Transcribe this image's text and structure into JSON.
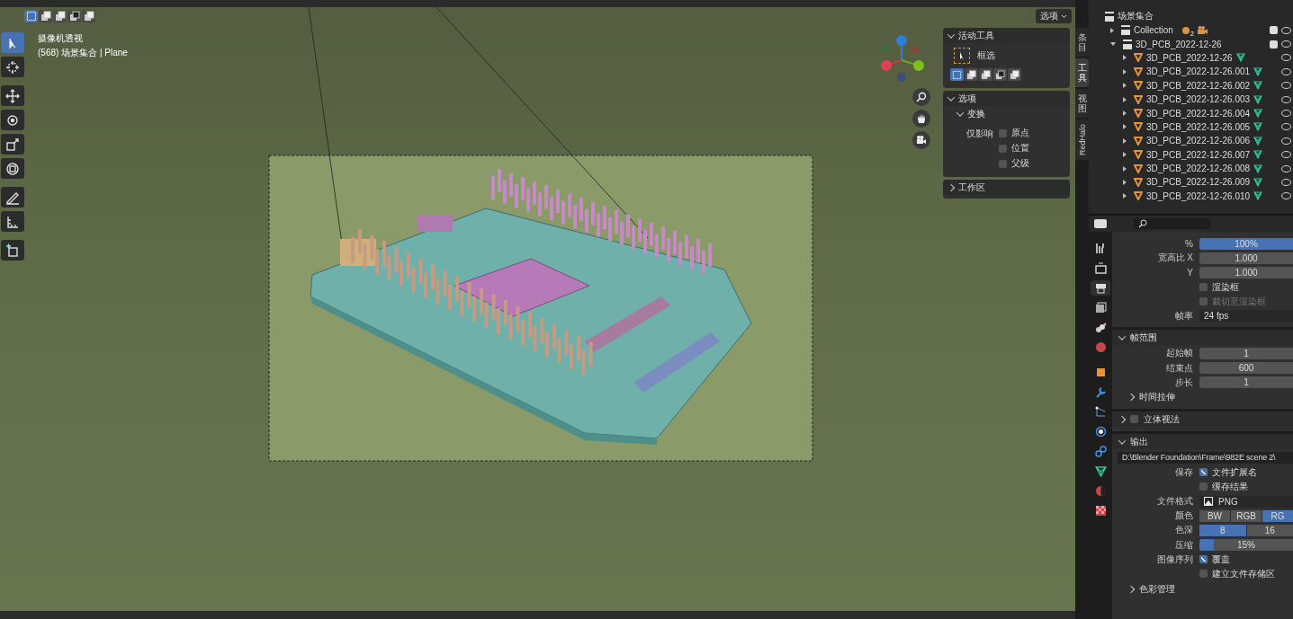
{
  "viewport_header": {
    "select_modes": [
      {
        "selected": true
      },
      {
        "selected": false
      },
      {
        "selected": false
      },
      {
        "selected": false
      },
      {
        "selected": false
      }
    ],
    "options_button": "选项"
  },
  "viewport": {
    "view_name": "摄像机透视",
    "context": "(568) 场景集合 | Plane"
  },
  "tools": [
    {
      "kind": "select",
      "selected": true
    },
    {
      "kind": "cursor",
      "selected": false
    },
    {
      "kind": "move",
      "selected": false
    },
    {
      "kind": "rotate",
      "selected": false
    },
    {
      "kind": "scale",
      "selected": false
    },
    {
      "kind": "transform",
      "selected": false
    },
    {
      "kind": "annotate",
      "selected": false
    },
    {
      "kind": "measure",
      "selected": false
    },
    {
      "kind": "add",
      "selected": false
    }
  ],
  "sidebar_panel": {
    "tool_title": "活动工具",
    "tool_expanded": true,
    "tool_name": "框选",
    "modes": [
      {
        "selected": true
      },
      {
        "selected": false
      },
      {
        "selected": false
      },
      {
        "selected": false
      },
      {
        "selected": false
      }
    ],
    "options_title": "选项",
    "options_expanded": true,
    "transform_title": "变换",
    "transform_expanded": true,
    "affect_label": "仅影响",
    "affect": [
      {
        "label": "原点",
        "checked": false
      },
      {
        "label": "位置",
        "checked": false
      },
      {
        "label": "父级",
        "checked": false
      }
    ],
    "workspace_title": "工作区",
    "workspace_expanded": false
  },
  "sidebar_tabs": [
    {
      "label": "条目",
      "kind": "cjk",
      "selected": false
    },
    {
      "label": "工具",
      "kind": "cjk",
      "selected": true
    },
    {
      "label": "视图",
      "kind": "cjk",
      "selected": false
    },
    {
      "label": "RedHalo",
      "kind": "latin",
      "selected": false
    }
  ],
  "outliner": {
    "root": "场景集合",
    "items": [
      {
        "name": "Collection",
        "expanded": false,
        "checked": true,
        "badge": "2"
      },
      {
        "name": "3D_PCB_2022-12-26",
        "expanded": true,
        "checked": true,
        "children": [
          {
            "name": "3D_PCB_2022-12-26",
            "expanded": false
          },
          {
            "name": "3D_PCB_2022-12-26.001",
            "expanded": false
          },
          {
            "name": "3D_PCB_2022-12-26.002",
            "expanded": false
          },
          {
            "name": "3D_PCB_2022-12-26.003",
            "expanded": false
          },
          {
            "name": "3D_PCB_2022-12-26.004",
            "expanded": false
          },
          {
            "name": "3D_PCB_2022-12-26.005",
            "expanded": false
          },
          {
            "name": "3D_PCB_2022-12-26.006",
            "expanded": false
          },
          {
            "name": "3D_PCB_2022-12-26.007",
            "expanded": false
          },
          {
            "name": "3D_PCB_2022-12-26.008",
            "expanded": false
          },
          {
            "name": "3D_PCB_2022-12-26.009",
            "expanded": false
          },
          {
            "name": "3D_PCB_2022-12-26.010",
            "expanded": false
          }
        ]
      }
    ]
  },
  "properties": {
    "tabs": [
      {
        "kind": "tool",
        "selected": false
      },
      {
        "kind": "render",
        "selected": false
      },
      {
        "kind": "output",
        "selected": true
      },
      {
        "kind": "view_layer",
        "selected": false
      },
      {
        "kind": "scene",
        "selected": false
      },
      {
        "kind": "world",
        "selected": false
      },
      {
        "kind": "object",
        "selected": false
      },
      {
        "kind": "modifier",
        "selected": false
      },
      {
        "kind": "particles",
        "selected": false
      },
      {
        "kind": "physics",
        "selected": false
      },
      {
        "kind": "constraints",
        "selected": false
      },
      {
        "kind": "data",
        "selected": false
      },
      {
        "kind": "material",
        "selected": false
      },
      {
        "kind": "texture",
        "selected": false
      }
    ],
    "rows": [
      {
        "kind": "slider",
        "label": "%",
        "value": "100%",
        "level": 1
      },
      {
        "kind": "number",
        "label": "宽高比 X",
        "value": "1.000"
      },
      {
        "kind": "number",
        "label": "Y",
        "value": "1.000"
      },
      {
        "kind": "checkbox",
        "text": "渲染框",
        "checked": false,
        "disabled": false
      },
      {
        "kind": "checkbox",
        "text": "裁切至渲染框",
        "checked": false,
        "disabled": true
      },
      {
        "kind": "dropdown",
        "label": "帧率",
        "value": "24 fps"
      },
      {
        "kind": "section",
        "title": "帧范围",
        "expanded": true
      },
      {
        "kind": "number",
        "label": "起始帧",
        "value": "1"
      },
      {
        "kind": "number",
        "label": "结束点",
        "value": "600"
      },
      {
        "kind": "number",
        "label": "步长",
        "value": "1"
      },
      {
        "kind": "subsection",
        "title": "时间拉伸",
        "expanded": false
      },
      {
        "kind": "section_check",
        "title": "立体视法",
        "expanded": false,
        "checked": false
      },
      {
        "kind": "section",
        "title": "输出",
        "expanded": true
      },
      {
        "kind": "path",
        "value": "D:\\Blender Foundation\\Frame\\982E scene 2\\"
      },
      {
        "kind": "checkbox",
        "label": "保存",
        "text": "文件扩展名",
        "checked": true,
        "disabled": false
      },
      {
        "kind": "checkbox",
        "text": "缓存结果",
        "checked": false,
        "disabled": false
      },
      {
        "kind": "format",
        "label": "文件格式",
        "value": "PNG"
      },
      {
        "kind": "segmented",
        "label": "颜色",
        "options": [
          {
            "text": "BW",
            "selected": false
          },
          {
            "text": "RGB",
            "selected": false
          },
          {
            "text": "RG",
            "selected": true
          }
        ]
      },
      {
        "kind": "segmented",
        "label": "色深",
        "options": [
          {
            "text": "8",
            "selected": true
          },
          {
            "text": "16",
            "selected": false
          }
        ]
      },
      {
        "kind": "slider",
        "label": "压缩",
        "value": "15%",
        "level": 0.15
      },
      {
        "kind": "checkbox",
        "label": "图像序列",
        "text": "覆盖",
        "checked": true,
        "disabled": false
      },
      {
        "kind": "checkbox",
        "text": "建立文件存储区",
        "checked": false,
        "disabled": false
      },
      {
        "kind": "subsection",
        "title": "色彩管理",
        "expanded": false
      }
    ]
  }
}
